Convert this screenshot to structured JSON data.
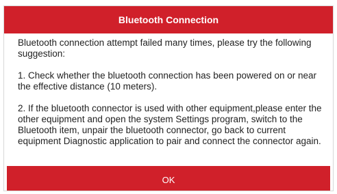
{
  "dialog": {
    "title": "Bluetooth Connection",
    "intro": "Bluetooth connection attempt failed many times, please try the following suggestion:",
    "suggestions": [
      "1. Check whether the bluetooth connection has been powered on or near the effective distance (10 meters).",
      "2. If the bluetooth connector is used with other equipment,please enter the other equipment and open the system Settings program, switch to the Bluetooth item, unpair the bluetooth connector, go back to current equipment Diagnostic application to pair and connect the connector again."
    ],
    "ok_label": "OK"
  },
  "colors": {
    "accent": "#d0202a",
    "text": "#222222",
    "background": "#ffffff"
  }
}
